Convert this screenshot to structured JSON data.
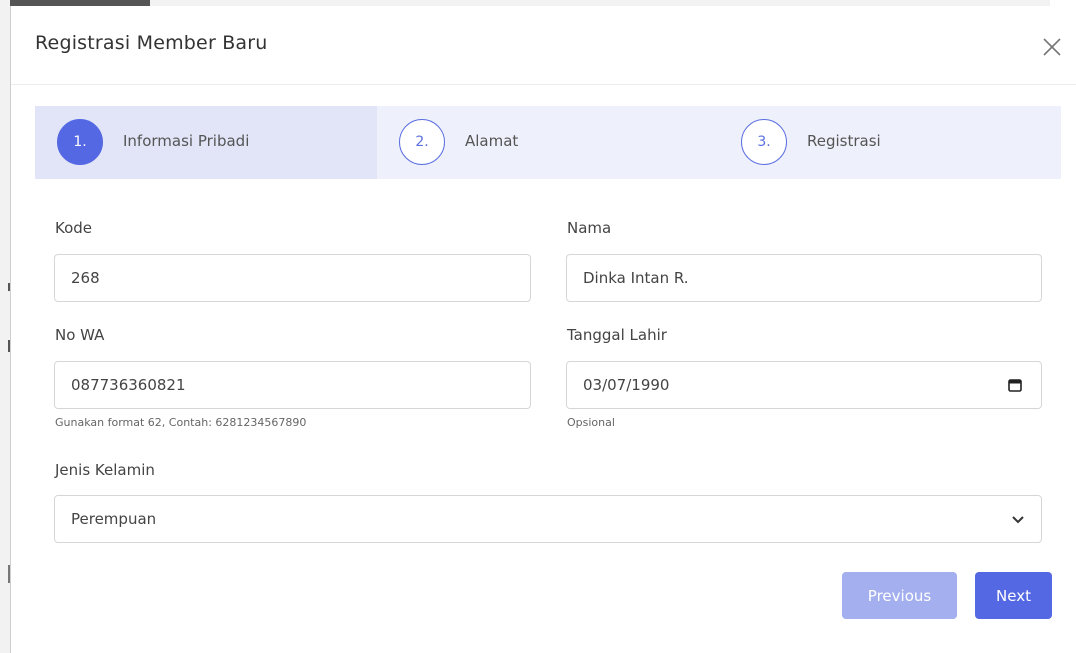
{
  "modal": {
    "title": "Registrasi Member Baru"
  },
  "steps": [
    {
      "number": "1.",
      "label": "Informasi Pribadi",
      "active": true
    },
    {
      "number": "2.",
      "label": "Alamat",
      "active": false
    },
    {
      "number": "3.",
      "label": "Registrasi",
      "active": false
    }
  ],
  "form": {
    "kode": {
      "label": "Kode",
      "value": "268"
    },
    "nama": {
      "label": "Nama",
      "value": "Dinka Intan R."
    },
    "no_wa": {
      "label": "No WA",
      "value": "087736360821",
      "hint": "Gunakan format 62, Contah: 6281234567890"
    },
    "tanggal_lahir": {
      "label": "Tanggal Lahir",
      "value": "03/07/1990",
      "hint": "Opsional"
    },
    "jenis_kelamin": {
      "label": "Jenis Kelamin",
      "value": "Perempuan"
    }
  },
  "buttons": {
    "previous": "Previous",
    "next": "Next"
  },
  "colors": {
    "accent": "#5468e3",
    "accent_light": "#a3afee",
    "steps_bg": "#eef0fb"
  },
  "icons": {
    "close": "close-icon",
    "calendar": "calendar-icon",
    "chevron": "chevron-down-icon"
  }
}
